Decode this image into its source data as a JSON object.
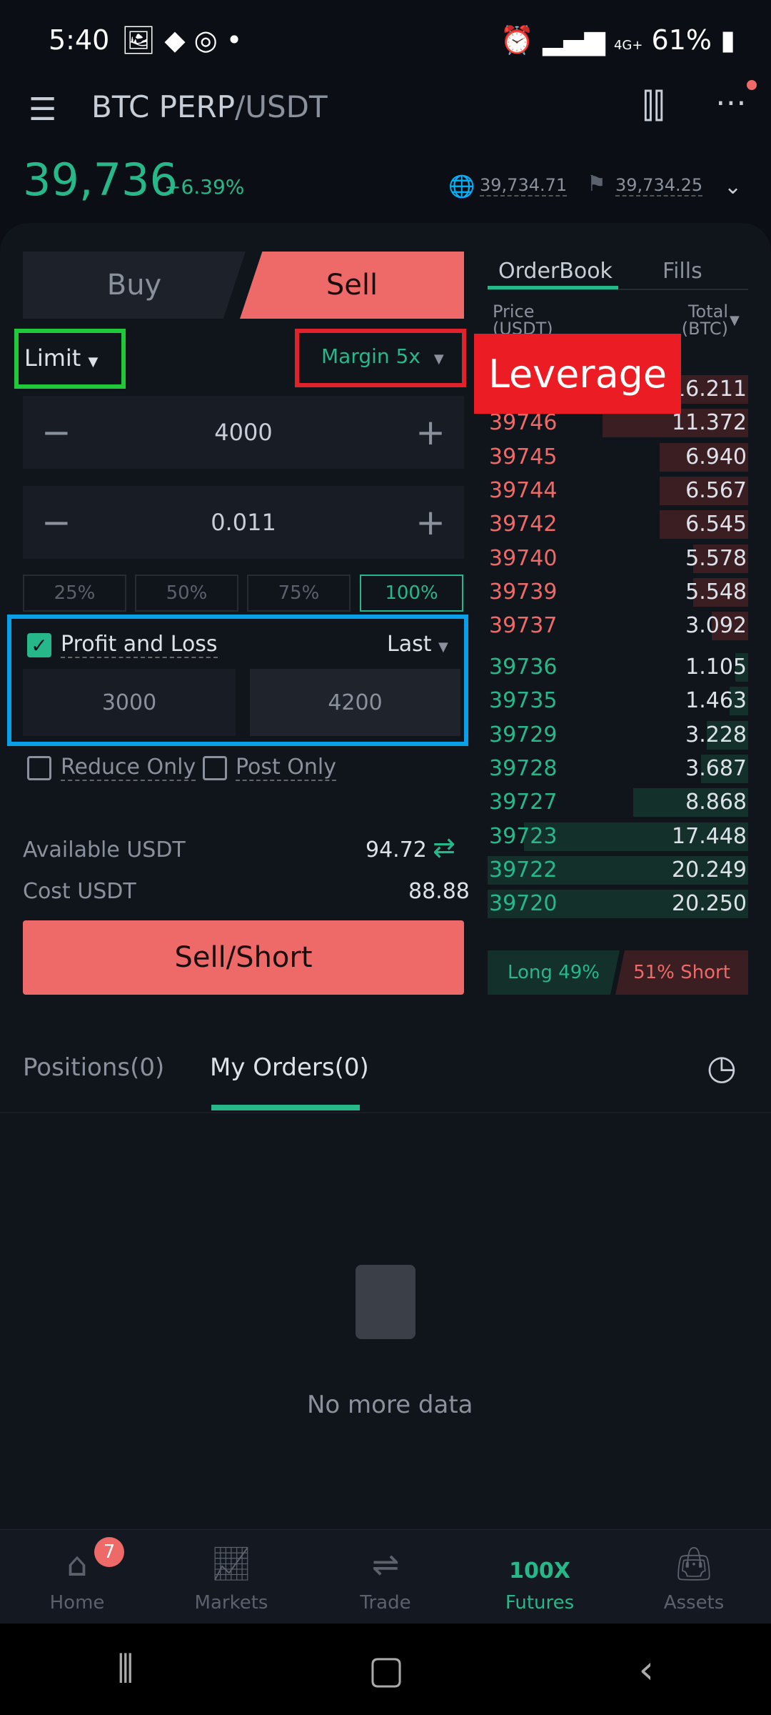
{
  "status_bar": {
    "time": "5:40",
    "battery": "61%",
    "network": "4G+"
  },
  "header": {
    "base": "BTC PERP",
    "quote": "/USDT",
    "last_price": "39,736",
    "change": "+6.39%",
    "index_price": "39,734.71",
    "mark_price": "39,734.25"
  },
  "order_form": {
    "tabs": {
      "buy": "Buy",
      "sell": "Sell"
    },
    "order_type": "Limit",
    "margin": "Margin 5x",
    "annotation": "Leverage",
    "price": "4000",
    "amount": "0.011",
    "percent_buttons": [
      "25%",
      "50%",
      "75%",
      "100%"
    ],
    "selected_percent": "100%",
    "pnl_label": "Profit and Loss",
    "pnl_checked": true,
    "pnl_trigger": "Last",
    "take_profit_low": "3000",
    "take_profit_high": "4200",
    "reduce_only": "Reduce Only",
    "post_only": "Post Only",
    "available_label": "Available USDT",
    "available_value": "94.72",
    "cost_label": "Cost USDT",
    "cost_value": "88.88",
    "submit": "Sell/Short"
  },
  "orderbook": {
    "tabs": [
      "OrderBook",
      "Fills"
    ],
    "price_header": "Price (USDT)",
    "total_header": "Total (BTC)",
    "asks": [
      {
        "price": "",
        "total": "16.211",
        "depth": 0.8
      },
      {
        "price": "39746",
        "total": "11.372",
        "depth": 0.56
      },
      {
        "price": "39745",
        "total": "6.940",
        "depth": 0.34
      },
      {
        "price": "39744",
        "total": "6.567",
        "depth": 0.34
      },
      {
        "price": "39742",
        "total": "6.545",
        "depth": 0.34
      },
      {
        "price": "39740",
        "total": "5.578",
        "depth": 0.21
      },
      {
        "price": "39739",
        "total": "5.548",
        "depth": 0.21
      },
      {
        "price": "39737",
        "total": "3.092",
        "depth": 0.14
      }
    ],
    "bids": [
      {
        "price": "39736",
        "total": "1.105",
        "depth": 0.05
      },
      {
        "price": "39735",
        "total": "1.463",
        "depth": 0.07
      },
      {
        "price": "39729",
        "total": "3.228",
        "depth": 0.16
      },
      {
        "price": "39728",
        "total": "3.687",
        "depth": 0.18
      },
      {
        "price": "39727",
        "total": "8.868",
        "depth": 0.44
      },
      {
        "price": "39723",
        "total": "17.448",
        "depth": 0.86
      },
      {
        "price": "39722",
        "total": "20.249",
        "depth": 1.0
      },
      {
        "price": "39720",
        "total": "20.250",
        "depth": 1.0
      }
    ],
    "long": "Long 49%",
    "short": "51% Short"
  },
  "orders": {
    "tabs": [
      "Positions(0)",
      "My Orders(0)"
    ],
    "active": 1,
    "empty": "No more data"
  },
  "bottom_nav": [
    {
      "label": "Home",
      "badge": "7"
    },
    {
      "label": "Markets"
    },
    {
      "label": "Trade"
    },
    {
      "label": "Futures",
      "icon_text": "100X"
    },
    {
      "label": "Assets"
    }
  ],
  "colors": {
    "green": "#27b88a",
    "red": "#ee6a68",
    "bg": "#0b0e14"
  }
}
